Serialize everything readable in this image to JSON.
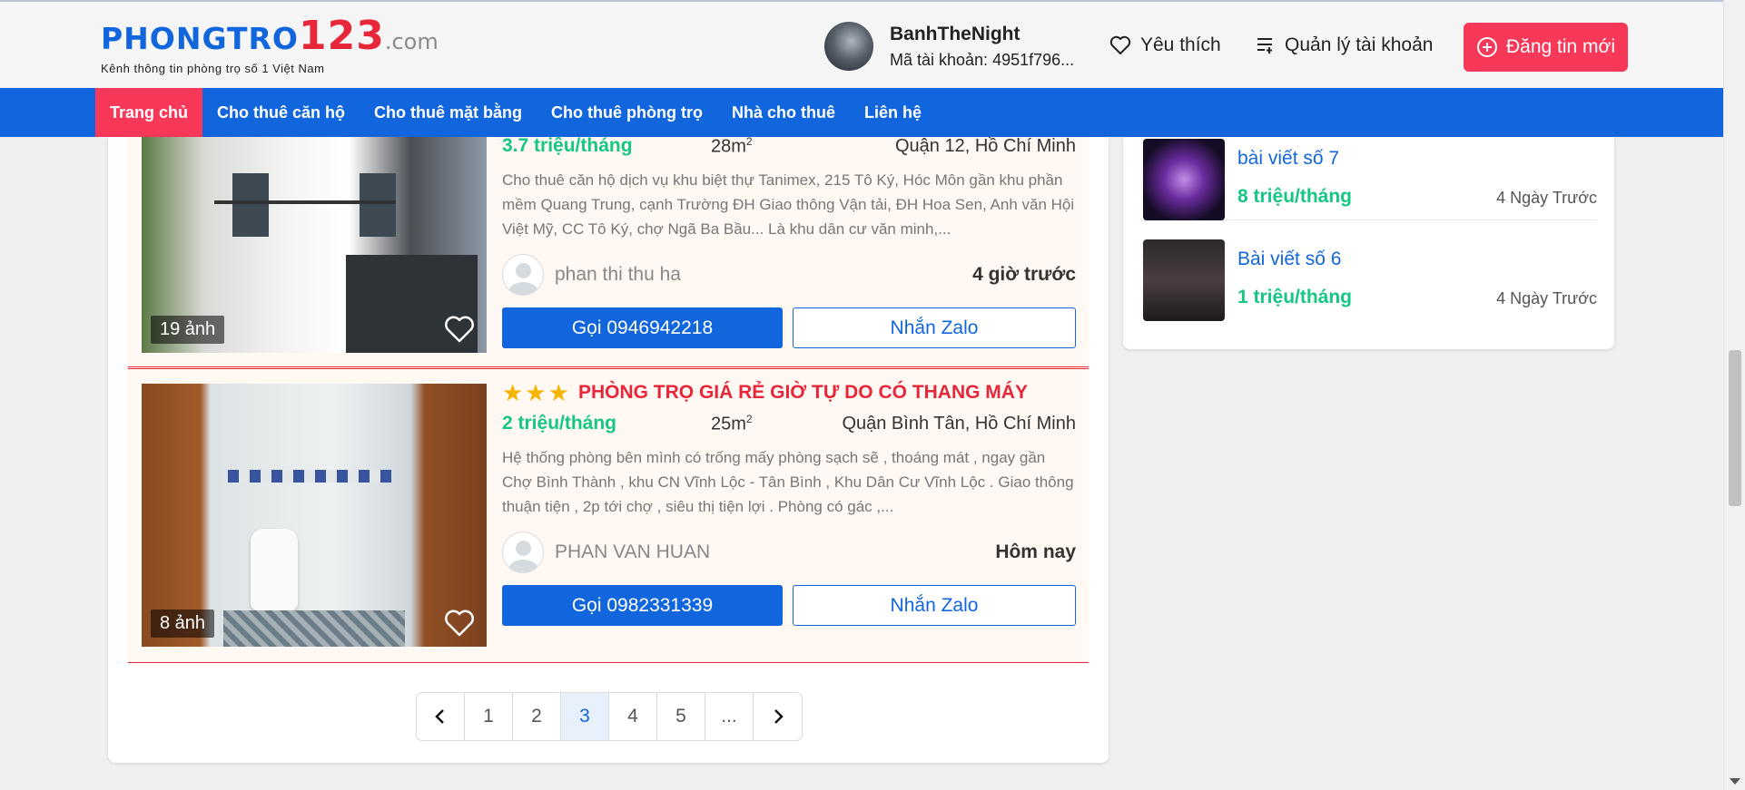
{
  "header": {
    "logo_main_1": "PHONGTRO",
    "logo_main_2": "123",
    "logo_main_3": ".com",
    "logo_tagline": "Kênh thông tin phòng trọ số 1 Việt Nam",
    "user_name": "BanhTheNight",
    "user_id": "Mã tài khoản: 4951f796...",
    "favorites_label": "Yêu thích",
    "account_label": "Quản lý tài khoản",
    "post_button_label": "Đăng tin mới"
  },
  "nav": {
    "items": [
      {
        "label": "Trang chủ",
        "active": true
      },
      {
        "label": "Cho thuê căn hộ"
      },
      {
        "label": "Cho thuê mặt bằng"
      },
      {
        "label": "Cho thuê phòng trọ"
      },
      {
        "label": "Nhà cho thuê"
      },
      {
        "label": "Liên hệ"
      }
    ]
  },
  "listings": [
    {
      "price": "3.7 triệu/tháng",
      "area": "28m",
      "area_unit_sup": "2",
      "location": "Quận 12, Hồ Chí Minh",
      "description": "Cho thuê căn hộ dịch vụ khu biệt thự Tanimex, 215 Tô Ký, Hóc Môn gần khu phần mềm Quang Trung, cạnh Trường ĐH Giao thông Vận tải, ĐH Hoa Sen, Anh văn Hội Việt Mỹ, CC Tô Ký, chợ Ngã Ba Bầu... Là khu dân cư văn minh,...",
      "author": "phan thi thu ha",
      "time": "4 giờ trước",
      "photo_count": "19 ảnh",
      "call_label": "Gọi 0946942218",
      "zalo_label": "Nhắn Zalo"
    },
    {
      "stars": "★★★",
      "title": "PHÒNG TRỌ GIÁ RẺ GIỜ TỰ DO CÓ THANG MÁY",
      "price": "2 triệu/tháng",
      "area": "25m",
      "area_unit_sup": "2",
      "location": "Quận Bình Tân, Hồ Chí Minh",
      "description": "Hệ thống phòng bên mình có trống mấy phòng sạch sẽ , thoáng mát , ngay gần Chợ Bình Thành , khu CN Vĩnh Lộc - Tân Bình , Khu Dân Cư Vĩnh Lộc . Giao thông thuận tiện , 2p tới chợ , siêu thị tiện lợi . Phòng có gác ,...",
      "author": "PHAN VAN HUAN",
      "time": "Hôm nay",
      "photo_count": "8 ảnh",
      "call_label": "Gọi 0982331339",
      "zalo_label": "Nhắn Zalo"
    }
  ],
  "pagination": {
    "pages": [
      "1",
      "2",
      "3",
      "4",
      "5",
      "..."
    ],
    "current": "3"
  },
  "sidebar": {
    "items": [
      {
        "title": "bài viết số 7",
        "price": "8 triệu/tháng",
        "time": "4 Ngày Trước"
      },
      {
        "title": "Bài viết số 6",
        "price": "1 triệu/tháng",
        "time": "4 Ngày Trước"
      }
    ]
  },
  "colors": {
    "brand_blue": "#1266dd",
    "brand_red": "#f73859",
    "price_green": "#16c784"
  }
}
